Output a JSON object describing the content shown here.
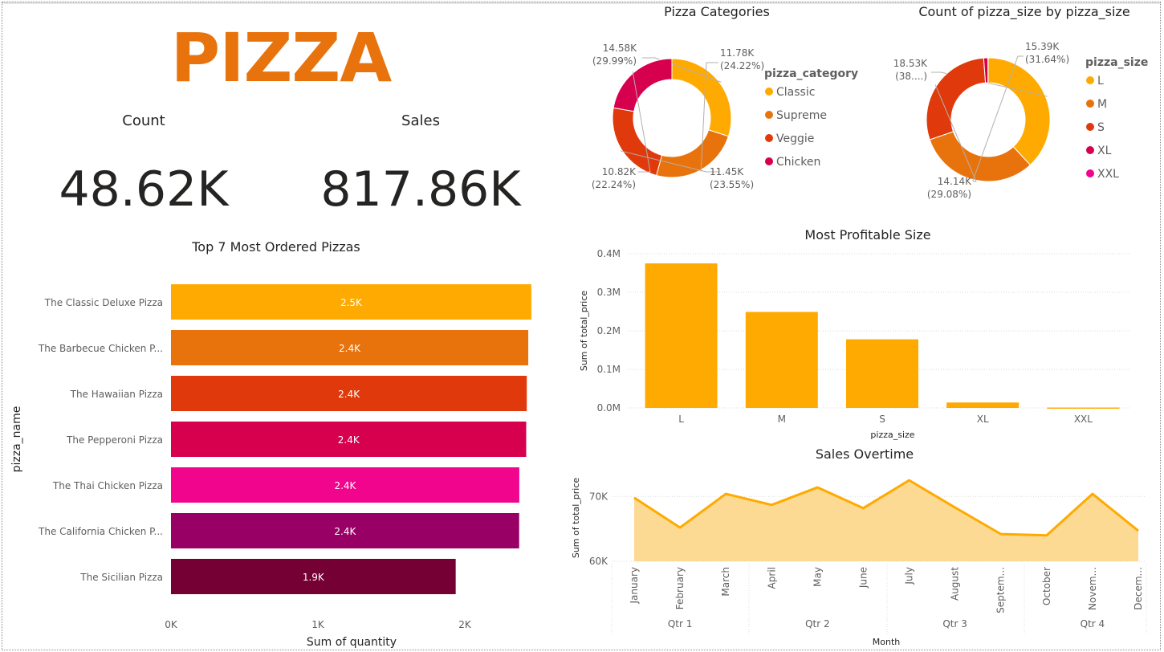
{
  "logo": "PIZZA",
  "kpis": [
    {
      "label": "Count",
      "value": "48.62K"
    },
    {
      "label": "Sales",
      "value": "817.86K"
    }
  ],
  "chart_data": [
    {
      "type": "bar",
      "orientation": "horizontal",
      "title": "Top 7 Most Ordered Pizzas",
      "xlabel": "Sum of quantity",
      "ylabel": "pizza_name",
      "categories": [
        "The Classic Deluxe Pizza",
        "The Barbecue Chicken P...",
        "The Hawaiian Pizza",
        "The Pepperoni Pizza",
        "The Thai Chicken Pizza",
        "The California Chicken P...",
        "The Sicilian Pizza"
      ],
      "values": [
        2453,
        2432,
        2422,
        2418,
        2371,
        2370,
        1938
      ],
      "data_labels": [
        "2.5K",
        "2.4K",
        "2.4K",
        "2.4K",
        "2.4K",
        "2.4K",
        "1.9K"
      ],
      "colors": [
        "#FFAA00",
        "#E8730C",
        "#E03A0C",
        "#D6004F",
        "#F0058C",
        "#990066",
        "#750033"
      ],
      "xlim": [
        0,
        2500
      ],
      "xticks": [
        "0K",
        "1K",
        "2K"
      ],
      "grid": false
    },
    {
      "type": "pie",
      "donut": true,
      "title": "Pizza Categories",
      "legend_title": "pizza_category",
      "legend_position": "right",
      "labels": [
        "Classic",
        "Supreme",
        "Veggie",
        "Chicken"
      ],
      "values": [
        14.58,
        11.78,
        11.45,
        10.82
      ],
      "data_labels": [
        [
          "14.58K",
          "(29.99%)"
        ],
        [
          "11.78K",
          "(24.22%)"
        ],
        [
          "11.45K",
          "(23.55%)"
        ],
        [
          "10.82K",
          "(22.24%)"
        ]
      ],
      "colors": [
        "#FFAA00",
        "#E8730C",
        "#E03A0C",
        "#D6004F"
      ]
    },
    {
      "type": "pie",
      "donut": true,
      "title": "Count of pizza_size by pizza_size",
      "legend_title": "pizza_size",
      "legend_position": "right",
      "labels": [
        "L",
        "M",
        "S",
        "XL",
        "XXL"
      ],
      "values": [
        18.53,
        15.39,
        14.14,
        0.54,
        0.03
      ],
      "data_labels": [
        [
          "18.53K",
          "(38....)"
        ],
        [
          "15.39K",
          "(31.64%)"
        ],
        [
          "14.14K",
          "(29.08%)"
        ],
        null,
        null
      ],
      "colors": [
        "#FFAA00",
        "#E8730C",
        "#E03A0C",
        "#D6004F",
        "#F0058C"
      ]
    },
    {
      "type": "bar",
      "title": "Most Profitable Size",
      "xlabel": "pizza_size",
      "ylabel": "Sum of total_price",
      "categories": [
        "L",
        "M",
        "S",
        "XL",
        "XXL"
      ],
      "values": [
        375000,
        249000,
        178000,
        14000,
        1000
      ],
      "color": "#FFAA00",
      "ylim": [
        0,
        400000
      ],
      "yticks": [
        0,
        100000,
        200000,
        300000,
        400000
      ],
      "ytick_labels": [
        "0.0M",
        "0.1M",
        "0.2M",
        "0.3M",
        "0.4M"
      ],
      "grid": true
    },
    {
      "type": "area",
      "title": "Sales Overtime",
      "xlabel": "Month",
      "ylabel": "Sum of total_price",
      "categories": [
        "January",
        "February",
        "March",
        "April",
        "May",
        "June",
        "July",
        "August",
        "Septem...",
        "October",
        "Novem...",
        "Decem..."
      ],
      "quarters": [
        "Qtr 1",
        "Qtr 2",
        "Qtr 3",
        "Qtr 4"
      ],
      "values": [
        69800,
        65200,
        70400,
        68700,
        71400,
        68200,
        72500,
        68300,
        64200,
        64000,
        70400,
        64700
      ],
      "line_color": "#FFAA00",
      "fill_color": "#FDDA94",
      "ylim": [
        60000,
        74500
      ],
      "yticks": [
        60000,
        70000
      ],
      "ytick_labels": [
        "60K",
        "70K"
      ],
      "grid": true
    }
  ]
}
